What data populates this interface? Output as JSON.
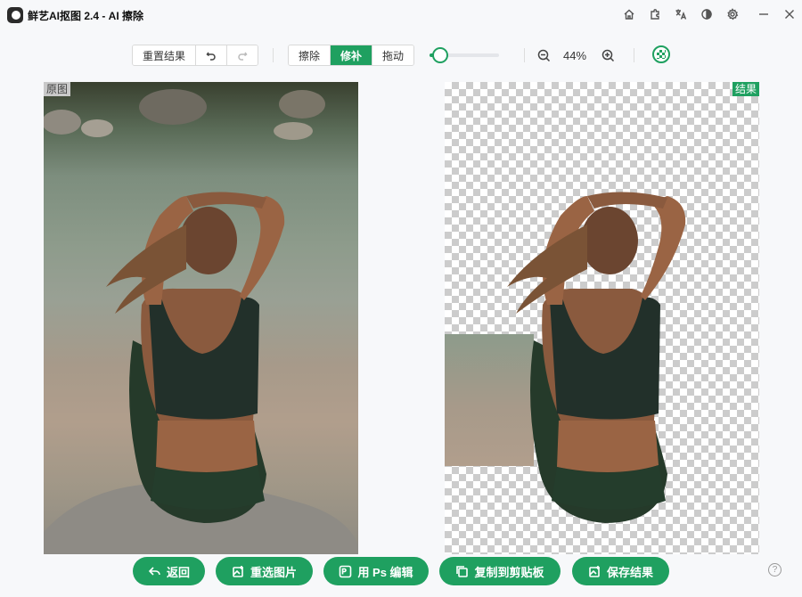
{
  "app": {
    "title": "鲜艺AI抠图  2.4 - AI 擦除"
  },
  "window_icons": [
    "home-icon",
    "puzzle-icon",
    "translate-icon",
    "contrast-icon",
    "gear-icon",
    "minimize-icon",
    "close-icon"
  ],
  "toolbar": {
    "reset_label": "重置结果",
    "undo_icon": "undo-icon",
    "redo_icon": "redo-icon",
    "modes": [
      "擦除",
      "修补",
      "拖动"
    ],
    "active_mode": "修补",
    "brush_size_fraction": 0.15,
    "zoom_text": "44%",
    "zoom_out_icon": "zoom-out-icon",
    "zoom_in_icon": "zoom-in-icon",
    "compare_icon": "transparency-icon"
  },
  "panels": {
    "original_tag": "原图",
    "result_tag": "结果"
  },
  "actions": {
    "back": "返回",
    "reselect": "重选图片",
    "ps_edit": "用 Ps 编辑",
    "copy": "复制到剪贴板",
    "save": "保存结果"
  },
  "colors": {
    "accent": "#1fa060"
  },
  "help_icon": "help-icon"
}
